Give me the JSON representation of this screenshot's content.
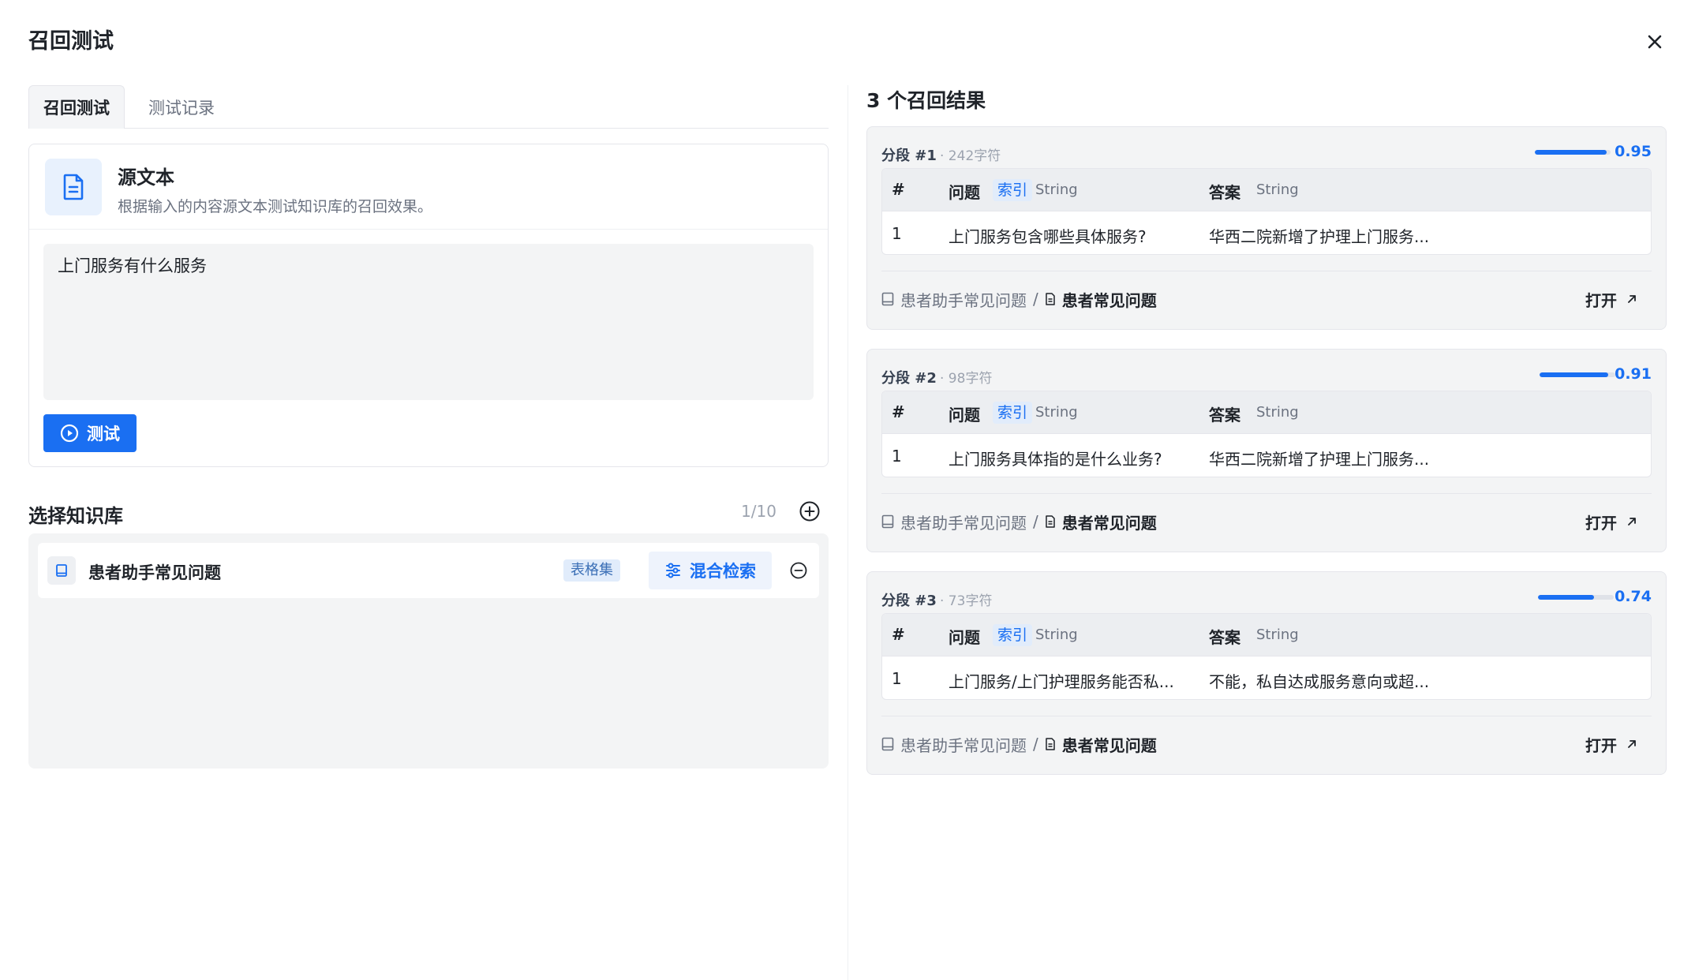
{
  "modal": {
    "title": "召回测试"
  },
  "tabs": [
    {
      "label": "召回测试"
    },
    {
      "label": "测试记录"
    }
  ],
  "source": {
    "title": "源文本",
    "description": "根据输入的内容源文本测试知识库的召回效果。",
    "text": "上门服务有什么服务",
    "test_label": "测试"
  },
  "kb_section": {
    "title": "选择知识库",
    "count": "1/10",
    "items": [
      {
        "name": "患者助手常见问题",
        "tag": "表格集",
        "mode": "混合检索"
      }
    ]
  },
  "results": {
    "title": "3 个召回结果",
    "header": {
      "num": "#",
      "q_label": "问题",
      "index_tag": "索引",
      "q_type": "String",
      "a_label": "答案",
      "a_type": "String"
    },
    "open_label": "打开",
    "items": [
      {
        "segment": "分段 #1",
        "chars": "· 242字符",
        "score": 0.95,
        "score_text": "0.95",
        "row": {
          "num": "1",
          "question": "上门服务包含哪些具体服务?",
          "answer": "华西二院新增了护理上门服务..."
        },
        "kb": "患者助手常见问题",
        "separator": "/",
        "doc": "患者常见问题"
      },
      {
        "segment": "分段 #2",
        "chars": "· 98字符",
        "score": 0.91,
        "score_text": "0.91",
        "row": {
          "num": "1",
          "question": "上门服务具体指的是什么业务?",
          "answer": "华西二院新增了护理上门服务..."
        },
        "kb": "患者助手常见问题",
        "separator": "/",
        "doc": "患者常见问题"
      },
      {
        "segment": "分段 #3",
        "chars": "· 73字符",
        "score": 0.74,
        "score_text": "0.74",
        "row": {
          "num": "1",
          "question": "上门服务/上门护理服务能否私...",
          "answer": "不能，私自达成服务意向或超..."
        },
        "kb": "患者助手常见问题",
        "separator": "/",
        "doc": "患者常见问题"
      }
    ]
  },
  "colors": {
    "accent": "#1a6ff2",
    "panel_bg": "#f3f4f5",
    "border": "#e5e6eb"
  },
  "icons": [
    "close-icon",
    "document-icon",
    "play-circle-icon",
    "add-circle-icon",
    "book-icon",
    "sliders-icon",
    "minus-circle-icon",
    "arrow-up-right-icon"
  ]
}
